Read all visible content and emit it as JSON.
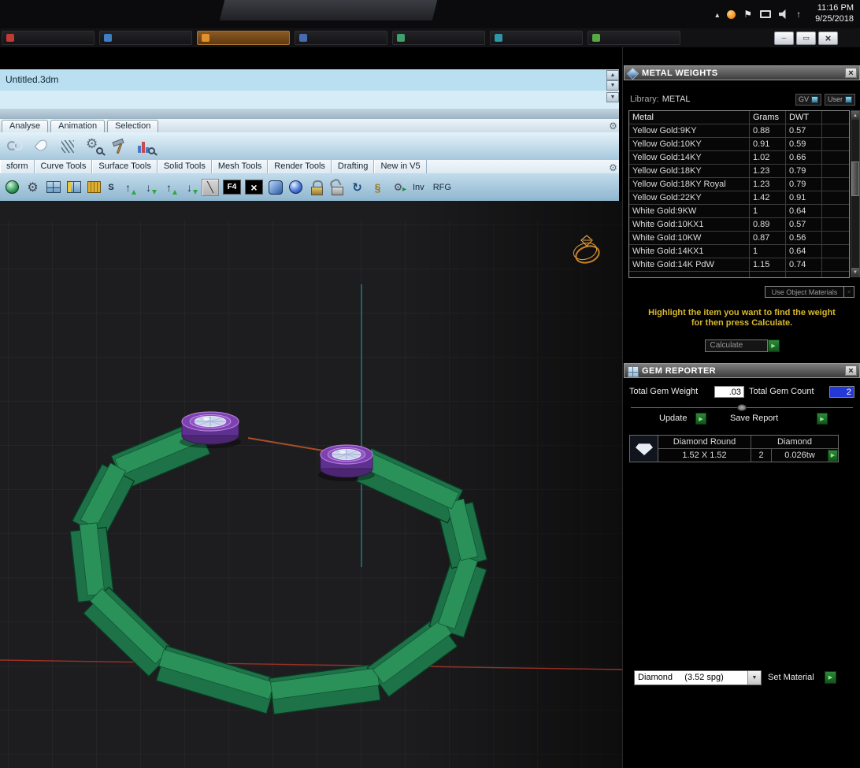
{
  "system_tray": {
    "time": "11:16 PM",
    "date": "9/25/2018"
  },
  "window": {
    "title": "Untitled.3dm"
  },
  "menu_tabs": [
    {
      "label": "Analyse"
    },
    {
      "label": "Animation"
    },
    {
      "label": "Selection"
    }
  ],
  "tool_tabs": [
    {
      "label": "sform"
    },
    {
      "label": "Curve Tools"
    },
    {
      "label": "Surface Tools"
    },
    {
      "label": "Solid Tools"
    },
    {
      "label": "Mesh Tools"
    },
    {
      "label": "Render Tools"
    },
    {
      "label": "Drafting"
    },
    {
      "label": "New in V5"
    }
  ],
  "toolbar": {
    "s_label": "S",
    "f4_label": "F4",
    "inv_label": "Inv",
    "rfg_label": "RFG"
  },
  "metal_weights": {
    "title": "METAL WEIGHTS",
    "library_label": "Library:",
    "library_value": "METAL",
    "gv_button": "GV",
    "user_button": "User",
    "table": {
      "columns": [
        "Metal",
        "Grams",
        "DWT"
      ],
      "rows": [
        {
          "metal": "Yellow Gold:9KY",
          "grams": "0.88",
          "dwt": "0.57"
        },
        {
          "metal": "Yellow Gold:10KY",
          "grams": "0.91",
          "dwt": "0.59"
        },
        {
          "metal": "Yellow Gold:14KY",
          "grams": "1.02",
          "dwt": "0.66"
        },
        {
          "metal": "Yellow Gold:18KY",
          "grams": "1.23",
          "dwt": "0.79"
        },
        {
          "metal": "Yellow Gold:18KY Royal",
          "grams": "1.23",
          "dwt": "0.79"
        },
        {
          "metal": "Yellow Gold:22KY",
          "grams": "1.42",
          "dwt": "0.91"
        },
        {
          "metal": "White Gold:9KW",
          "grams": "1",
          "dwt": "0.64"
        },
        {
          "metal": "White Gold:10KX1",
          "grams": "0.89",
          "dwt": "0.57"
        },
        {
          "metal": "White Gold:10KW",
          "grams": "0.87",
          "dwt": "0.56"
        },
        {
          "metal": "White Gold:14KX1",
          "grams": "1",
          "dwt": "0.64"
        },
        {
          "metal": "White Gold:14K PdW",
          "grams": "1.15",
          "dwt": "0.74"
        }
      ]
    },
    "use_object_materials": "Use Object Materials",
    "instruction_line1": "Highlight the item you want to find the weight",
    "instruction_line2": "for then press Calculate.",
    "calculate_button": "Calculate"
  },
  "gem_reporter": {
    "title": "GEM REPORTER",
    "total_weight_label": "Total Gem Weight",
    "total_weight_value": ".03",
    "total_count_label": "Total Gem Count",
    "total_count_value": "2",
    "update_button": "Update",
    "save_report_button": "Save Report",
    "gem_table": {
      "name": "Diamond Round",
      "material": "Diamond",
      "size": "1.52 X 1.52",
      "count": "2",
      "weight": "0.026tw"
    },
    "material_select": "Diamond     (3.52 spg)",
    "set_material_button": "Set Material"
  },
  "colors": {
    "ring_green": "#1d7347",
    "setting_purple": "#7d41b2",
    "axis_red": "#9a3126",
    "axis_teal": "#1f7e86",
    "instruction_yellow": "#d8b92a",
    "arrow_button_green": "#2f8a3a",
    "count_highlight_blue": "#2438d8"
  }
}
